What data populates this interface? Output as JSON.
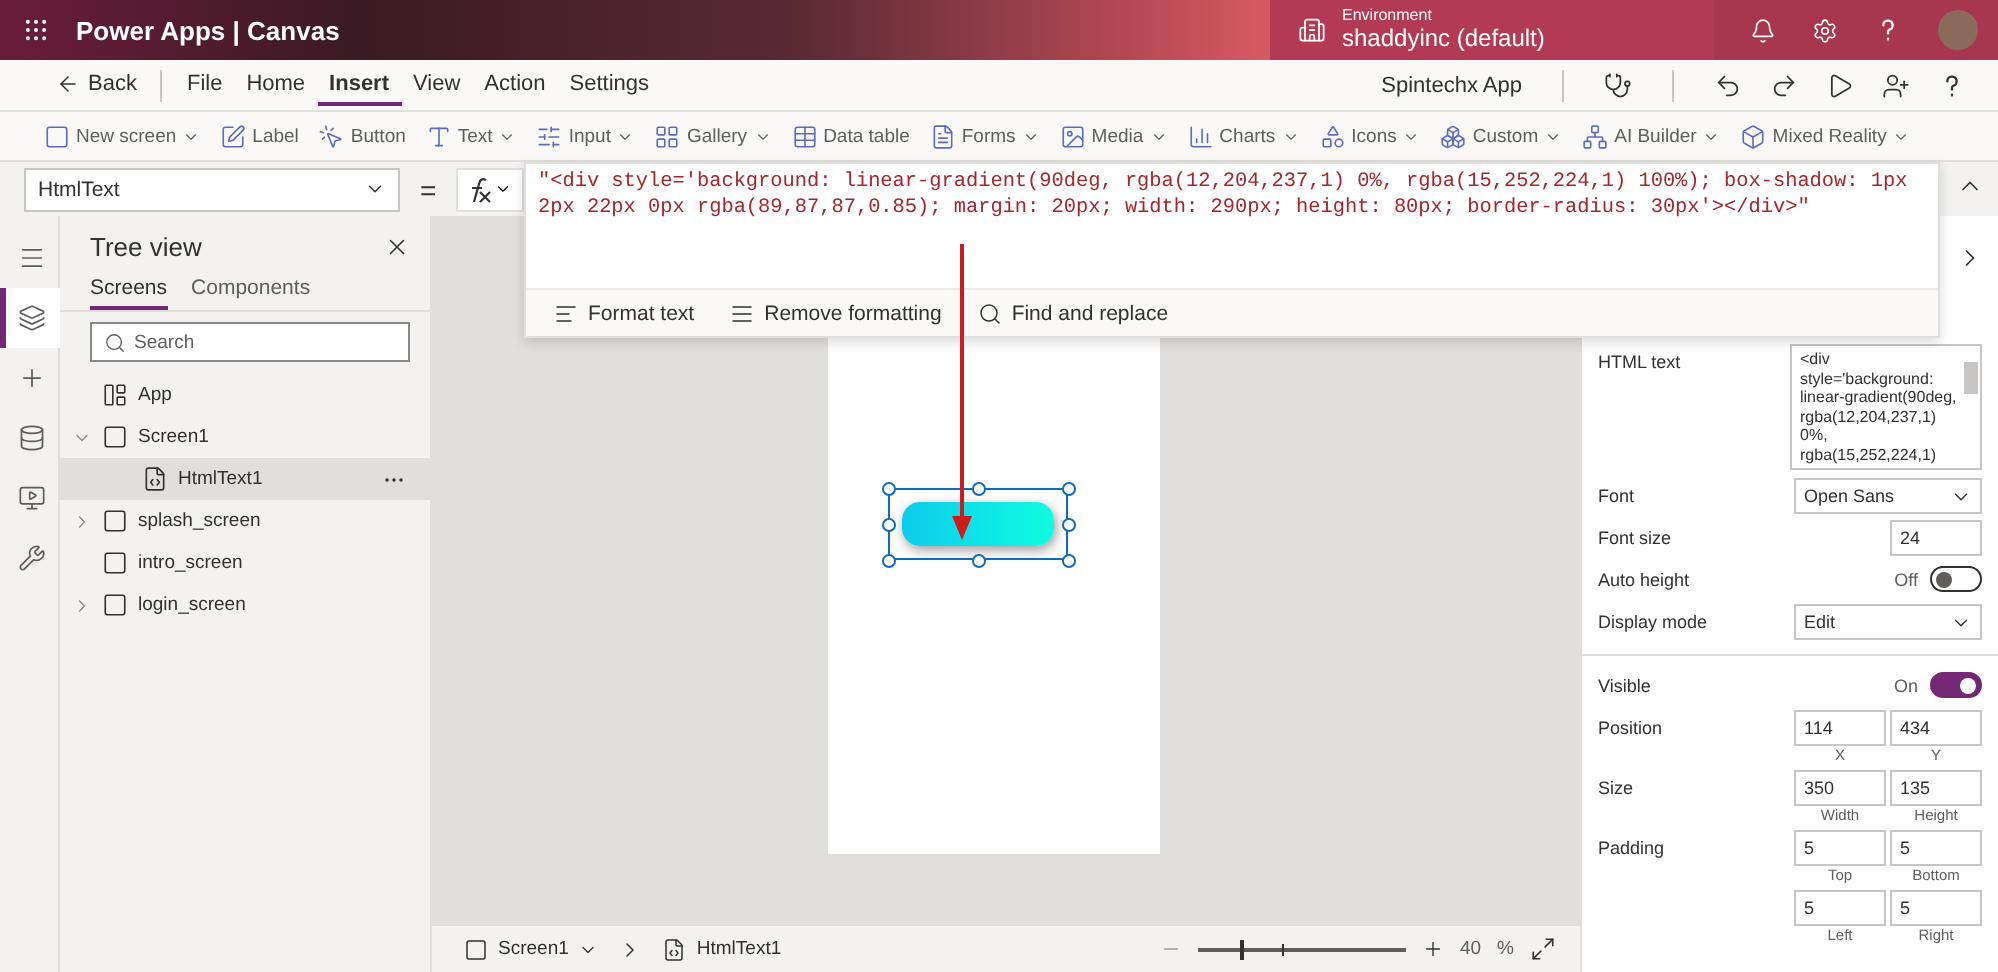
{
  "top_bar": {
    "product": "Power Apps",
    "separator": "|",
    "mode": "Canvas",
    "environment_label": "Environment",
    "environment": "shaddyinc (default)"
  },
  "menu": {
    "back": "Back",
    "tabs": [
      {
        "label": "File",
        "selected": false
      },
      {
        "label": "Home",
        "selected": false
      },
      {
        "label": "Insert",
        "selected": true
      },
      {
        "label": "View",
        "selected": false
      },
      {
        "label": "Action",
        "selected": false
      },
      {
        "label": "Settings",
        "selected": false
      }
    ],
    "app_name": "Spintechx App"
  },
  "toolbar": [
    {
      "kind": "screen",
      "label": "New screen",
      "dropdown": true
    },
    {
      "kind": "label",
      "label": "Label",
      "dropdown": false
    },
    {
      "kind": "button",
      "label": "Button",
      "dropdown": false
    },
    {
      "kind": "text",
      "label": "Text",
      "dropdown": true
    },
    {
      "kind": "input",
      "label": "Input",
      "dropdown": true
    },
    {
      "kind": "gallery",
      "label": "Gallery",
      "dropdown": true
    },
    {
      "kind": "table",
      "label": "Data table",
      "dropdown": false
    },
    {
      "kind": "forms",
      "label": "Forms",
      "dropdown": true
    },
    {
      "kind": "media",
      "label": "Media",
      "dropdown": true
    },
    {
      "kind": "charts",
      "label": "Charts",
      "dropdown": true
    },
    {
      "kind": "icons",
      "label": "Icons",
      "dropdown": true
    },
    {
      "kind": "custom",
      "label": "Custom",
      "dropdown": true
    },
    {
      "kind": "ai",
      "label": "AI Builder",
      "dropdown": true
    },
    {
      "kind": "mr",
      "label": "Mixed Reality",
      "dropdown": true
    }
  ],
  "formula_bar": {
    "property": "HtmlText",
    "equals": "=",
    "formula": "\"<div style='background: linear-gradient(90deg, rgba(12,204,237,1) 0%, rgba(15,252,224,1) 100%); box-shadow: 1px 2px 22px 0px rgba(89,87,87,0.85); margin: 20px; width: 290px; height: 80px; border-radius: 30px'></div>\"",
    "actions": [
      {
        "kind": "format",
        "label": "Format text"
      },
      {
        "kind": "remove",
        "label": "Remove formatting"
      },
      {
        "kind": "find",
        "label": "Find and replace"
      }
    ]
  },
  "rail": [
    {
      "kind": "tree",
      "selected": true
    },
    {
      "kind": "insert",
      "selected": false
    },
    {
      "kind": "data",
      "selected": false
    },
    {
      "kind": "media",
      "selected": false
    },
    {
      "kind": "tools",
      "selected": false
    }
  ],
  "tree_view": {
    "title": "Tree view",
    "tabs": [
      {
        "label": "Screens",
        "selected": true
      },
      {
        "label": "Components",
        "selected": false
      }
    ],
    "search": {
      "placeholder": "Search"
    },
    "items": [
      {
        "kind": "app",
        "label": "App",
        "selected": false
      },
      {
        "kind": "screen",
        "label": "Screen1",
        "selected": false,
        "expanded": true,
        "children": [
          {
            "kind": "html",
            "label": "HtmlText1",
            "selected": true
          }
        ]
      },
      {
        "kind": "screen",
        "label": "splash_screen",
        "selected": false,
        "expanded": false
      },
      {
        "kind": "screen",
        "label": "intro_screen",
        "selected": false
      },
      {
        "kind": "screen",
        "label": "login_screen",
        "selected": false,
        "expanded": false
      }
    ]
  },
  "status_bar": {
    "screen": "Screen1",
    "control": "HtmlText1",
    "zoom": {
      "level": 0.2,
      "reading": "40",
      "unit": "%"
    }
  },
  "properties": [
    {
      "kind": "textarea",
      "label": "HTML text",
      "value": "<div style='background: linear-gradient(90deg, rgba(12,204,237,1) 0%, rgba(15,252,224,1)"
    },
    {
      "kind": "select",
      "label": "Font",
      "value": "Open Sans"
    },
    {
      "kind": "input",
      "label": "Font size",
      "value": "24"
    },
    {
      "kind": "toggle",
      "label": "Auto height",
      "on": false,
      "state": "Off"
    },
    {
      "kind": "select",
      "label": "Display mode",
      "value": "Edit"
    },
    {
      "kind": "divider"
    },
    {
      "kind": "toggle",
      "label": "Visible",
      "on": true,
      "state": "On"
    },
    {
      "kind": "pair",
      "label": "Position",
      "fields": [
        {
          "value": "114",
          "caption": "X"
        },
        {
          "value": "434",
          "caption": "Y"
        }
      ]
    },
    {
      "kind": "pair",
      "label": "Size",
      "fields": [
        {
          "value": "350",
          "caption": "Width"
        },
        {
          "value": "135",
          "caption": "Height"
        }
      ]
    },
    {
      "kind": "pair",
      "label": "Padding",
      "fields": [
        {
          "value": "5",
          "caption": "Top"
        },
        {
          "value": "5",
          "caption": "Bottom"
        }
      ]
    },
    {
      "kind": "pair",
      "fields": [
        {
          "value": "5",
          "caption": "Left"
        },
        {
          "value": "5",
          "caption": "Right"
        }
      ]
    }
  ]
}
